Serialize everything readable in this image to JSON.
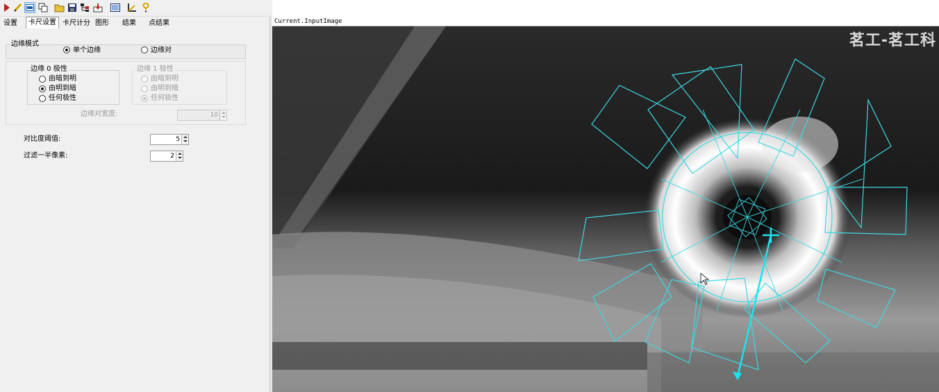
{
  "tabs": [
    "设置",
    "卡尺设置",
    "卡尺计分",
    "图形",
    "结果",
    "点结果"
  ],
  "active_tab_index": 1,
  "edge_mode": {
    "title": "边缘模式",
    "option_single": "单个边缘",
    "option_pair": "边缘对",
    "selected": "单个边缘"
  },
  "edge0": {
    "title": "边缘 0 极性",
    "options": [
      "由暗到明",
      "由明到暗",
      "任何极性"
    ],
    "selected": "由明到暗"
  },
  "edge1": {
    "title": "边缘 1 极性",
    "options": [
      "由暗到明",
      "由明到暗",
      "任何极性"
    ],
    "selected": "任何极性",
    "disabled": true
  },
  "pair_width": {
    "label": "边缘对宽度:",
    "value": "10"
  },
  "contrast": {
    "label": "对比度阈值:",
    "value": "5"
  },
  "filter": {
    "label": "过滤一半像素:",
    "value": "2"
  },
  "image": {
    "title": "Current.InputImage",
    "watermark": "茗工-茗工科"
  },
  "colors": {
    "overlay": "#3fd7e0",
    "overlay_bright": "#19e4f0"
  },
  "icons": [
    "run-icon",
    "pencil-icon",
    "image-mode-icon",
    "copy-icon",
    "open-folder-icon",
    "save-icon",
    "tree-icon",
    "import-icon",
    "display-icon",
    "ruler-icon",
    "help-icon"
  ]
}
